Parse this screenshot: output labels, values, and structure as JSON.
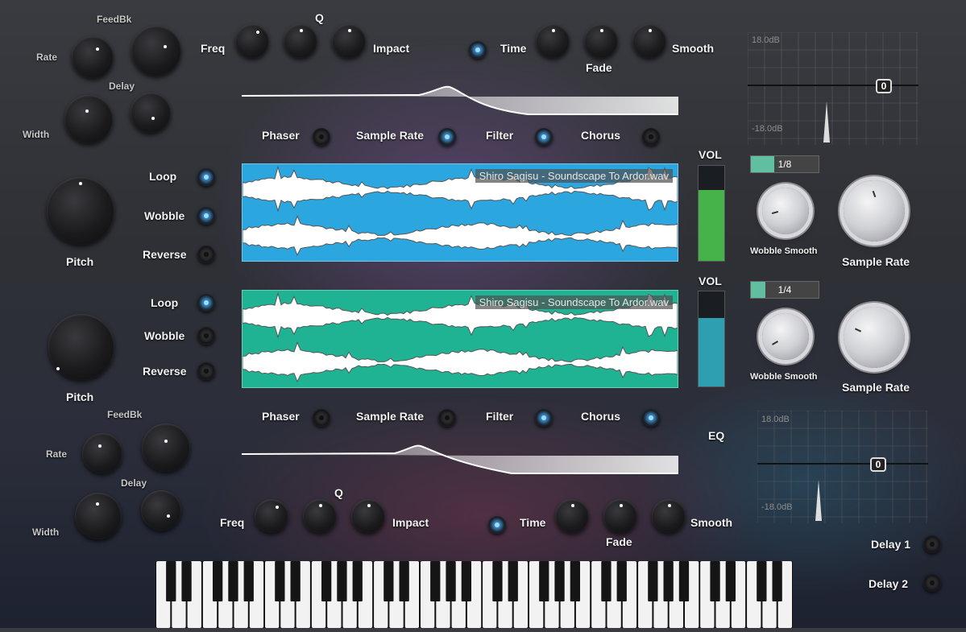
{
  "top_fx": {
    "feedbk": "FeedBk",
    "rate": "Rate",
    "delay": "Delay",
    "width": "Width",
    "freq": "Freq",
    "q": "Q",
    "impact": "Impact",
    "time": "Time",
    "fade": "Fade",
    "smooth": "Smooth"
  },
  "bottom_fx": {
    "feedbk": "FeedBk",
    "rate": "Rate",
    "delay": "Delay",
    "width": "Width",
    "freq": "Freq",
    "q": "Q",
    "impact": "Impact",
    "time": "Time",
    "fade": "Fade",
    "smooth": "Smooth"
  },
  "top_effects": [
    "Phaser",
    "Sample Rate",
    "Filter",
    "Chorus"
  ],
  "bottom_effects": [
    "Phaser",
    "Sample Rate",
    "Filter",
    "Chorus"
  ],
  "layer1": {
    "pitch": "Pitch",
    "loop": "Loop",
    "wobble": "Wobble",
    "reverse": "Reverse",
    "filename": "Shiro Sagisu - Soundscape To Ardor.wav",
    "vol_label": "VOL",
    "vol_level": 0.75,
    "wobble_rate": "1/8",
    "wobble_rate_fill": 0.35,
    "wobble_smooth": "Wobble Smooth",
    "sample_rate": "Sample Rate",
    "wave_color": "#2ba6de",
    "meter_color": "#45b24a"
  },
  "layer2": {
    "pitch": "Pitch",
    "loop": "Loop",
    "wobble": "Wobble",
    "reverse": "Reverse",
    "filename": "Shiro Sagisu - Soundscape To Ardor.wav",
    "vol_label": "VOL",
    "vol_level": 0.72,
    "wobble_rate": "1/4",
    "wobble_rate_fill": 0.22,
    "wobble_smooth": "Wobble Smooth",
    "sample_rate": "Sample Rate",
    "wave_color": "#1fb394",
    "meter_color": "#2d9fb1"
  },
  "eq": {
    "label": "EQ",
    "top_max": "18.0dB",
    "top_min": "-18.0dB",
    "top_value": "0",
    "bottom_max": "18.0dB",
    "bottom_min": "-18.0dB",
    "bottom_value": "0"
  },
  "delays": {
    "delay1": "Delay 1",
    "delay2": "Delay 2"
  },
  "accent": "#3aa8ff"
}
